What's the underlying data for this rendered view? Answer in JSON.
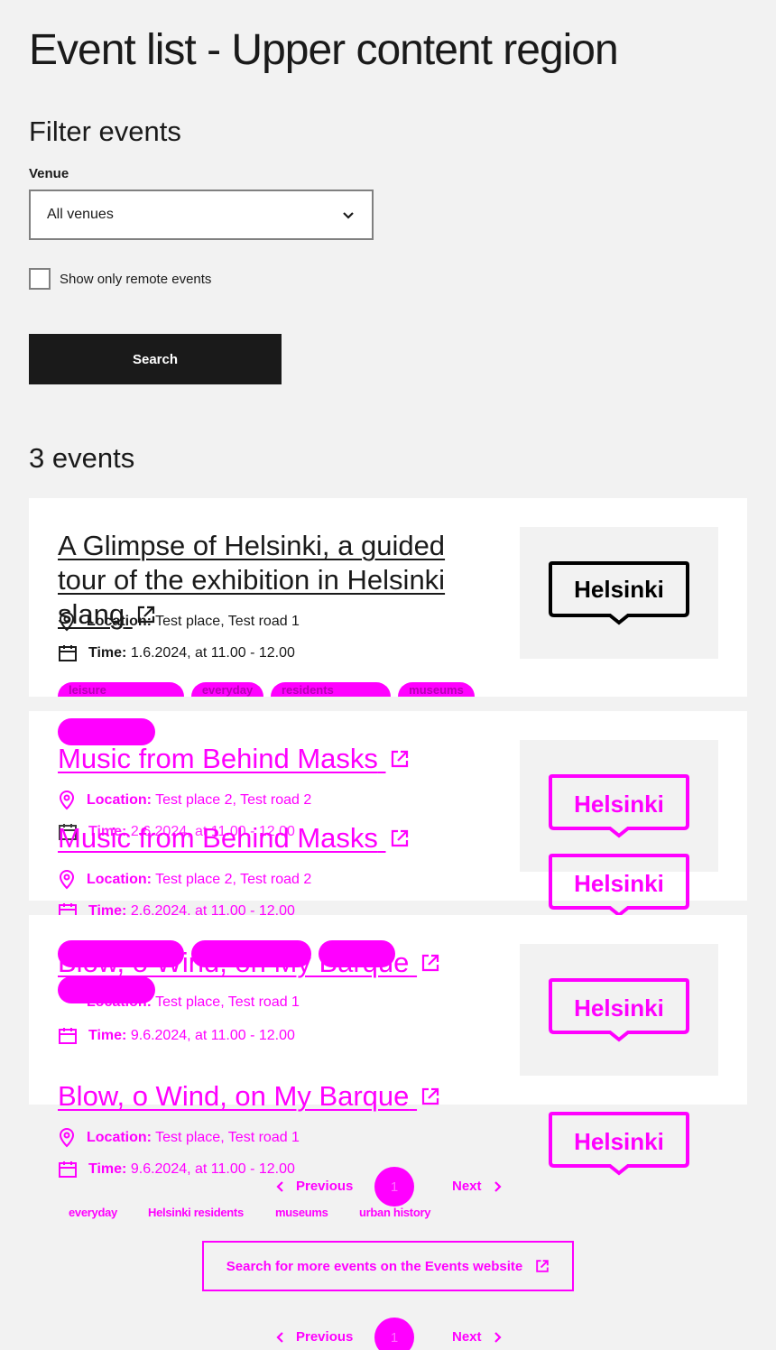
{
  "page": {
    "title": "Event list - Upper content region"
  },
  "filter": {
    "heading": "Filter events",
    "venue_label": "Venue",
    "venue_selected": "All venues",
    "remote_label": "Show only remote events",
    "search_label": "Search"
  },
  "results": {
    "count_label": "3 events"
  },
  "labels": {
    "location": "Location:",
    "time": "Time:"
  },
  "events": [
    {
      "title": "A Glimpse of Helsinki, a guided tour of the exhibition in Helsinki slang",
      "location": "Test place, Test road 1",
      "time": "1.6.2024, at 11.00 - 12.00",
      "logo_text": "Helsinki",
      "tags": [
        "Culture and leisure",
        "everyday",
        "Helsinki residents",
        "museums"
      ]
    },
    {
      "title": "Music from Behind Masks",
      "location": "Test place 2, Test road 2",
      "time": "2.6.2024, at 11.00 - 12.00",
      "logo_text": "Helsinki"
    },
    {
      "title": "Blow, o Wind, on My Barque",
      "location": "Test place, Test road 1",
      "time": "9.6.2024, at 11.00 - 12.00",
      "logo_text": "Helsinki",
      "tags": [
        "everyday",
        "Helsinki residents",
        "museums",
        "urban history"
      ]
    }
  ],
  "pagination": {
    "previous": "Previous",
    "current": "1",
    "next": "Next"
  },
  "more_events": {
    "label": "Search for more events on the Events website"
  },
  "colors": {
    "accent": "#ff00ff",
    "dark": "#1a1a1a",
    "background": "#f2f2f2"
  }
}
